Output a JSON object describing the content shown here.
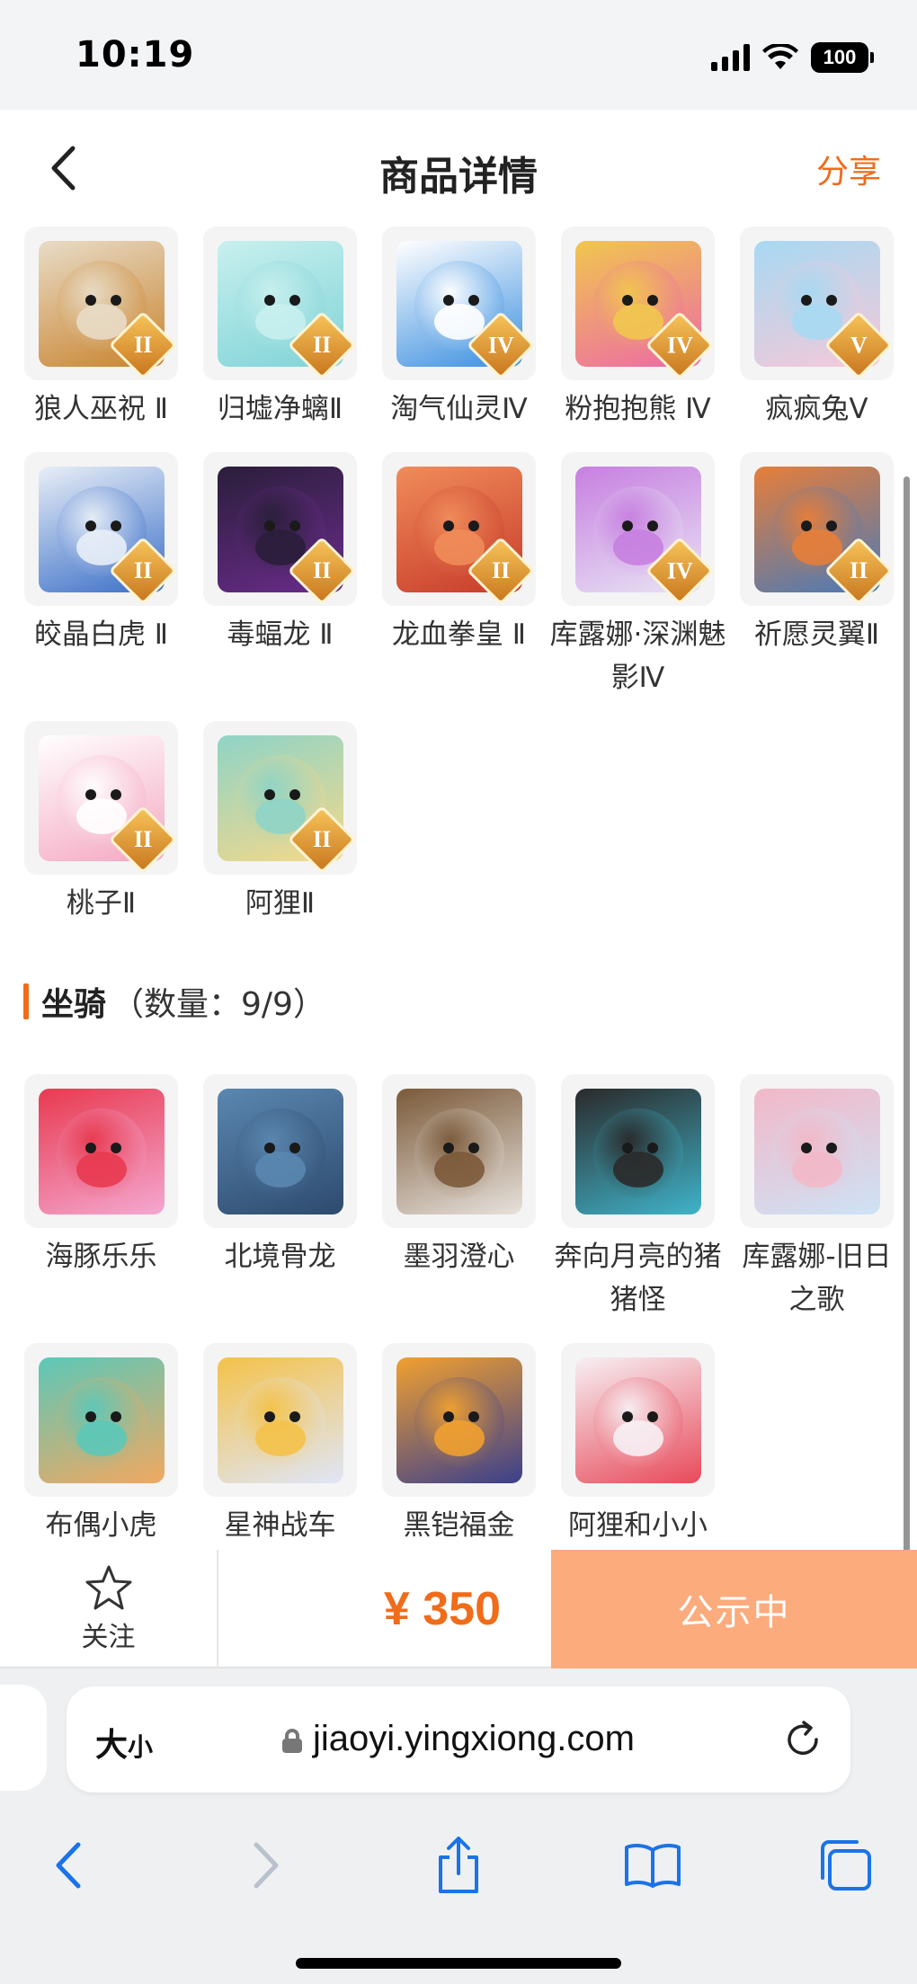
{
  "status_bar": {
    "time": "10:19",
    "battery": "100"
  },
  "header": {
    "title": "商品详情",
    "share_label": "分享"
  },
  "pets": [
    {
      "name": "狼人巫祝 Ⅱ",
      "rank": "II",
      "palette": [
        "#c9832d",
        "#e8dcc7"
      ]
    },
    {
      "name": "归墟净螭Ⅱ",
      "rank": "II",
      "palette": [
        "#7fd3d7",
        "#c8f0ee"
      ]
    },
    {
      "name": "淘气仙灵Ⅳ",
      "rank": "IV",
      "palette": [
        "#3a8fe0",
        "#ffffff"
      ]
    },
    {
      "name": "粉抱抱熊 Ⅳ",
      "rank": "IV",
      "palette": [
        "#ec6aa6",
        "#f1c64f"
      ]
    },
    {
      "name": "疯疯兔Ⅴ",
      "rank": "V",
      "palette": [
        "#f6c8d8",
        "#a7d9f2"
      ]
    },
    {
      "name": "皎晶白虎 Ⅱ",
      "rank": "II",
      "palette": [
        "#3a6fc8",
        "#e8eef7"
      ]
    },
    {
      "name": "毒蝠龙 Ⅱ",
      "rank": "II",
      "palette": [
        "#6b2c8c",
        "#2a1e3a"
      ]
    },
    {
      "name": "龙血拳皇 Ⅱ",
      "rank": "II",
      "palette": [
        "#c73b2a",
        "#f08c5a"
      ]
    },
    {
      "name": "库露娜·深渊魅影Ⅳ",
      "rank": "IV",
      "palette": [
        "#e8e4f4",
        "#c77fe0"
      ]
    },
    {
      "name": "祈愿灵翼Ⅱ",
      "rank": "II",
      "palette": [
        "#4a7ab8",
        "#e67e3a"
      ]
    },
    {
      "name": "桃子Ⅱ",
      "rank": "II",
      "palette": [
        "#f4a7c1",
        "#ffffff"
      ]
    },
    {
      "name": "阿狸Ⅱ",
      "rank": "II",
      "palette": [
        "#f5d88a",
        "#8fd4c6"
      ]
    }
  ],
  "mounts_section": {
    "title": "坐骑",
    "count": "（数量：9/9）"
  },
  "mounts": [
    {
      "name": "海豚乐乐",
      "palette": [
        "#f4a8d0",
        "#e83a50"
      ]
    },
    {
      "name": "北境骨龙",
      "palette": [
        "#2e4a6e",
        "#5a87b0"
      ]
    },
    {
      "name": "墨羽澄心",
      "palette": [
        "#e7e2dc",
        "#7b5a3a"
      ]
    },
    {
      "name": "奔向月亮的猪猪怪",
      "palette": [
        "#3fb3c9",
        "#2a2a2a"
      ]
    },
    {
      "name": "库露娜-旧日之歌",
      "palette": [
        "#cde3f5",
        "#f2b8c8"
      ]
    },
    {
      "name": "布偶小虎",
      "palette": [
        "#f2a860",
        "#5cc8b8"
      ]
    },
    {
      "name": "星神战车",
      "palette": [
        "#dfe6f8",
        "#f4c24a"
      ]
    },
    {
      "name": "黑铠福金",
      "palette": [
        "#3b3f8c",
        "#f0a030"
      ]
    },
    {
      "name": "阿狸和小小",
      "palette": [
        "#e84a5a",
        "#f7f0f4"
      ]
    }
  ],
  "action_bar": {
    "follow_label": "关注",
    "price": "¥ 350",
    "status_label": "公示中"
  },
  "browser": {
    "text_size_label": "大",
    "text_size_small": "小",
    "url": "jiaoyi.yingxiong.com"
  }
}
